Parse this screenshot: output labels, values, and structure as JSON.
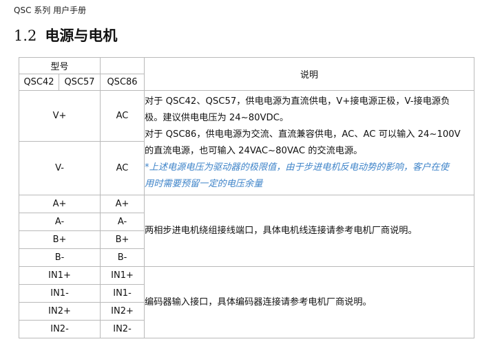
{
  "header": "QSC 系列  用户手册",
  "section": {
    "number": "1.2",
    "title": "电源与电机"
  },
  "table": {
    "model_header": "型号",
    "desc_header": "说明",
    "models": [
      "QSC42",
      "QSC57",
      "QSC86"
    ],
    "power": {
      "rows": [
        {
          "dc": "V+",
          "ac": "AC"
        },
        {
          "dc": "V-",
          "ac": "AC"
        }
      ],
      "desc_lines": [
        "对于 QSC42、QSC57，供电电源为直流供电，V+接电源正极，V-接电源负",
        "极。建议供电电压为 24~80VDC。",
        "对于 QSC86，供电电源为交流、直流兼容供电，AC、AC 可以输入 24~100V",
        "的直流电源，也可输入 24VAC~80VAC 的交流电源。"
      ],
      "note_lines": [
        "*上述电源电压为驱动器的极限值，由于步进电机反电动势的影响，客户在使",
        "用时需要预留一定的电压余量"
      ]
    },
    "motor": {
      "rows": [
        {
          "a": "A+",
          "b": "A+"
        },
        {
          "a": "A-",
          "b": "A-"
        },
        {
          "a": "B+",
          "b": "B+"
        },
        {
          "a": "B-",
          "b": "B-"
        }
      ],
      "desc": "两相步进电机绕组接线端口，具体电机线连接请参考电机厂商说明。"
    },
    "encoder": {
      "rows": [
        {
          "a": "IN1+",
          "b": "IN1+"
        },
        {
          "a": "IN1-",
          "b": "IN1-"
        },
        {
          "a": "IN2+",
          "b": "IN2+"
        },
        {
          "a": "IN2-",
          "b": "IN2-"
        }
      ],
      "desc": "编码器输入接口，具体编码器连接请参考电机厂商说明。"
    }
  }
}
